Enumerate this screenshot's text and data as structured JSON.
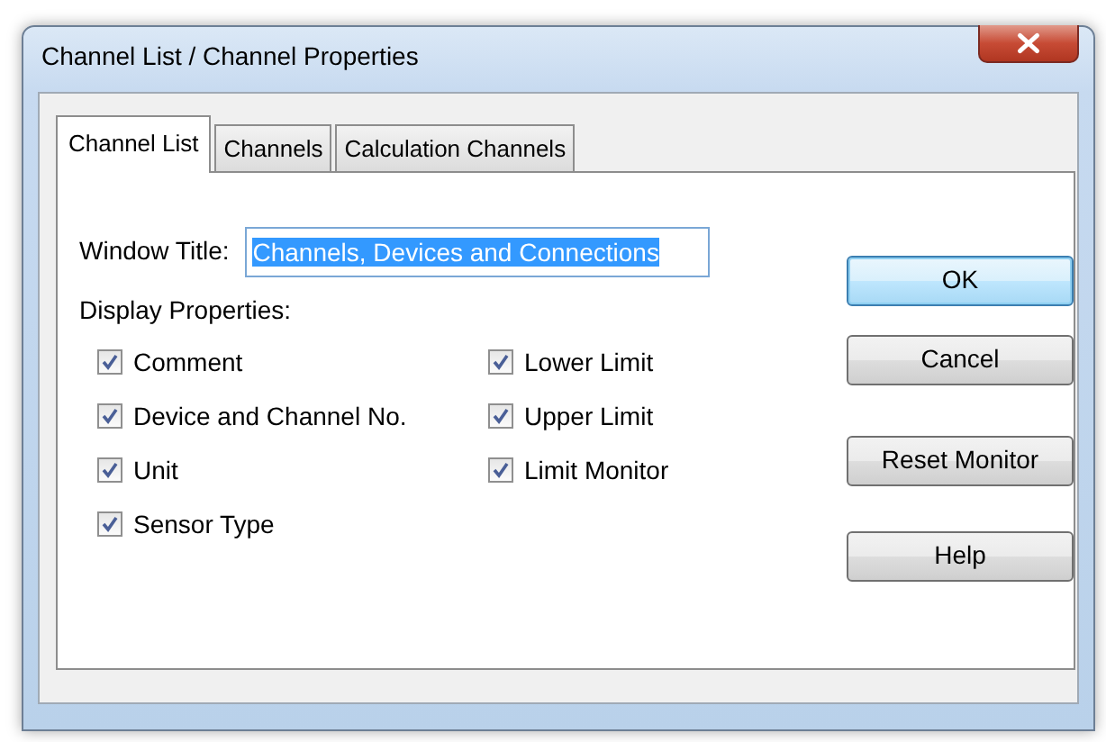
{
  "window": {
    "title": "Channel List / Channel Properties"
  },
  "tabs": [
    {
      "label": "Channel List",
      "selected": true
    },
    {
      "label": "Channels",
      "selected": false
    },
    {
      "label": "Calculation Channels",
      "selected": false
    }
  ],
  "window_title_field": {
    "label": "Window Title:",
    "value": "Channels, Devices and Connections",
    "text_selected": true
  },
  "display_properties": {
    "label": "Display Properties:",
    "columns": [
      [
        {
          "label": "Comment",
          "checked": true
        },
        {
          "label": "Device and Channel No.",
          "checked": true
        },
        {
          "label": "Unit",
          "checked": true
        },
        {
          "label": "Sensor Type",
          "checked": true
        }
      ],
      [
        {
          "label": "Lower Limit",
          "checked": true
        },
        {
          "label": "Upper Limit",
          "checked": true
        },
        {
          "label": "Limit Monitor",
          "checked": true
        }
      ]
    ]
  },
  "buttons": [
    {
      "label": "OK",
      "default": true
    },
    {
      "label": "Cancel",
      "default": false
    },
    {
      "label": "Reset Monitor",
      "default": false
    },
    {
      "label": "Help",
      "default": false
    }
  ]
}
